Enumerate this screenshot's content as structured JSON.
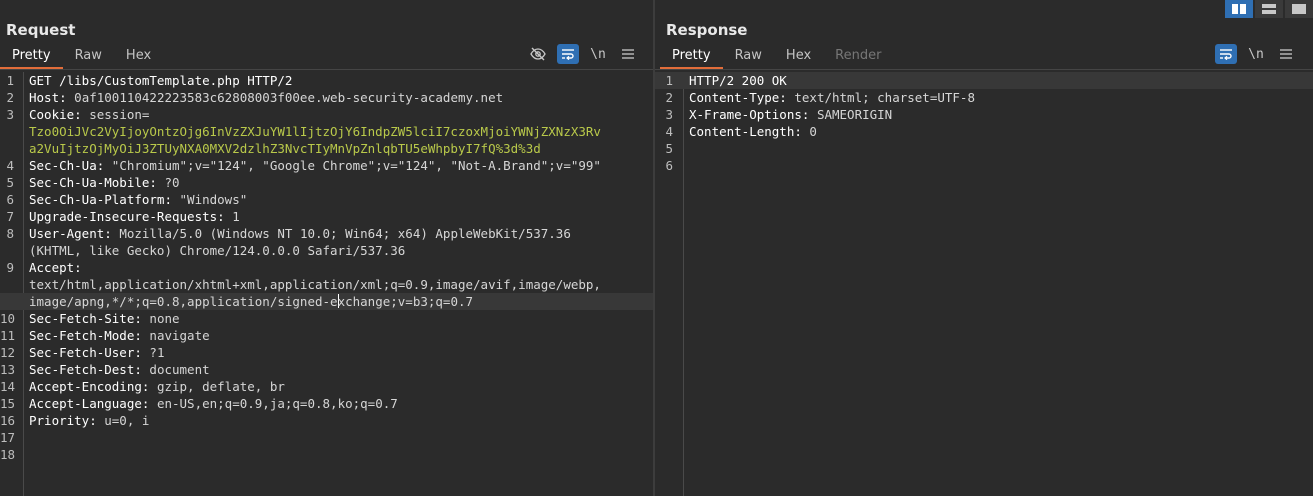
{
  "request": {
    "title": "Request",
    "tabs": [
      "Pretty",
      "Raw",
      "Hex"
    ],
    "active_tab": "Pretty",
    "tools": {
      "hide_icon": "eye-off-icon",
      "wrap_icon": "wrap-icon",
      "newline_label": "\\n",
      "menu_icon": "hamburger-icon"
    },
    "lines": [
      {
        "n": "1",
        "name": "GET /libs/CustomTemplate.php HTTP/2",
        "val": ""
      },
      {
        "n": "2",
        "name": "Host:",
        "val": " 0af100110422223583c62808003f00ee.web-security-academy.net"
      },
      {
        "n": "3",
        "name": "Cookie:",
        "val": " session="
      },
      {
        "n": "",
        "name": "",
        "val": "",
        "cookie": "Tzo0OiJVc2VyIjoyOntzOjg6InVzZXJuYW1lIjtzOjY6IndpZW5lciI7czoxMjoiYWNjZXNzX3Rv"
      },
      {
        "n": "",
        "name": "",
        "val": "",
        "cookie": "a2VuIjtzOjMyOiJ3ZTUyNXA0MXV2dzlhZ3NvcTIyMnVpZnlqbTU5eWhpbyI7fQ%3d%3d"
      },
      {
        "n": "4",
        "name": "Sec-Ch-Ua:",
        "val": " \"Chromium\";v=\"124\", \"Google Chrome\";v=\"124\", \"Not-A.Brand\";v=\"99\""
      },
      {
        "n": "5",
        "name": "Sec-Ch-Ua-Mobile:",
        "val": " ?0"
      },
      {
        "n": "6",
        "name": "Sec-Ch-Ua-Platform:",
        "val": " \"Windows\""
      },
      {
        "n": "7",
        "name": "Upgrade-Insecure-Requests:",
        "val": " 1"
      },
      {
        "n": "8",
        "name": "User-Agent:",
        "val": " Mozilla/5.0 (Windows NT 10.0; Win64; x64) AppleWebKit/537.36"
      },
      {
        "n": "",
        "name": "",
        "val": "(KHTML, like Gecko) Chrome/124.0.0.0 Safari/537.36"
      },
      {
        "n": "9",
        "name": "Accept:",
        "val": ""
      },
      {
        "n": "",
        "name": "",
        "val": "text/html,application/xhtml+xml,application/xml;q=0.9,image/avif,image/webp,"
      },
      {
        "n": "",
        "name": "",
        "val": "image/apng,*/*;q=0.8,application/signed-exchange;v=b3;q=0.7",
        "highlight": true
      },
      {
        "n": "10",
        "name": "Sec-Fetch-Site:",
        "val": " none"
      },
      {
        "n": "11",
        "name": "Sec-Fetch-Mode:",
        "val": " navigate"
      },
      {
        "n": "12",
        "name": "Sec-Fetch-User:",
        "val": " ?1"
      },
      {
        "n": "13",
        "name": "Sec-Fetch-Dest:",
        "val": " document"
      },
      {
        "n": "14",
        "name": "Accept-Encoding:",
        "val": " gzip, deflate, br"
      },
      {
        "n": "15",
        "name": "Accept-Language:",
        "val": " en-US,en;q=0.9,ja;q=0.8,ko;q=0.7"
      },
      {
        "n": "16",
        "name": "Priority:",
        "val": " u=0, i"
      },
      {
        "n": "17",
        "name": "",
        "val": ""
      },
      {
        "n": "18",
        "name": "",
        "val": ""
      }
    ]
  },
  "response": {
    "title": "Response",
    "tabs": [
      "Pretty",
      "Raw",
      "Hex",
      "Render"
    ],
    "active_tab": "Pretty",
    "disabled_tab": "Render",
    "tools": {
      "wrap_icon": "wrap-icon",
      "newline_label": "\\n",
      "menu_icon": "hamburger-icon"
    },
    "lines": [
      {
        "n": "1",
        "name": "HTTP/2 200 OK",
        "val": "",
        "highlight": true
      },
      {
        "n": "2",
        "name": "Content-Type:",
        "val": " text/html; charset=UTF-8"
      },
      {
        "n": "3",
        "name": "X-Frame-Options:",
        "val": " SAMEORIGIN"
      },
      {
        "n": "4",
        "name": "Content-Length:",
        "val": " 0"
      },
      {
        "n": "5",
        "name": "",
        "val": ""
      },
      {
        "n": "6",
        "name": "",
        "val": ""
      }
    ]
  },
  "layout_switch": {
    "icons": [
      "side-by-side-icon",
      "stacked-icon",
      "single-pane-icon"
    ],
    "active": "side-by-side-icon"
  },
  "colors": {
    "accent_tab": "#e26d3a",
    "active_tool": "#2f6fb3",
    "cookie_value": "#b9c94a",
    "background": "#2b2b2b"
  }
}
